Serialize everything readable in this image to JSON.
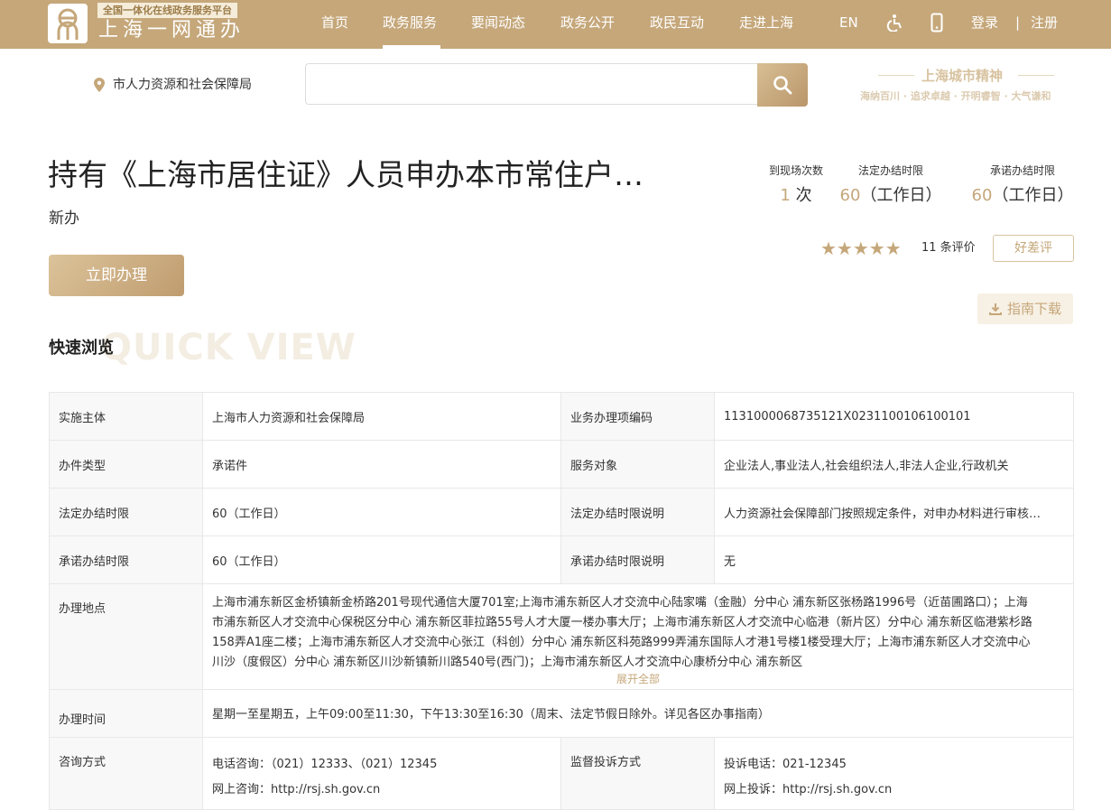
{
  "header": {
    "logo_tagline": "全国一体化在线政务服务平台",
    "logo_name": "上海一网通办",
    "nav": [
      "首页",
      "政务服务",
      "要闻动态",
      "政务公开",
      "政民互动",
      "走进上海"
    ],
    "lang": "EN",
    "login": "登录",
    "separator": "|",
    "register": "注册"
  },
  "search": {
    "location": "市人力资源和社会保障局",
    "placeholder": "",
    "spirit_title": "上海城市精神",
    "spirit_subtitle": "海纳百川 · 追求卓越 · 开明睿智 · 大气谦和"
  },
  "item": {
    "title": "持有《上海市居住证》人员申办本市常住户…",
    "subtitle": "新办",
    "apply_button": "立即办理",
    "stats": [
      {
        "label": "到现场次数",
        "num": "1",
        "unit": "次"
      },
      {
        "label": "法定办结时限",
        "num": "60",
        "unit": "（工作日）"
      },
      {
        "label": "承诺办结时限",
        "num": "60",
        "unit": "（工作日）"
      }
    ],
    "rating_stars": 5,
    "stars_text": "★★★★★",
    "review_count": "11 条评价",
    "review_button": "好差评",
    "guide_download": "指南下载"
  },
  "quick_view": {
    "title": "快速浏览",
    "bg_text": "QUICK VIEW",
    "rows": {
      "r1": {
        "l1": "实施主体",
        "v1": "上海市人力资源和社会保障局",
        "l2": "业务办理项编码",
        "v2": "1131000068735121X0231100106100101"
      },
      "r2": {
        "l1": "办件类型",
        "v1": "承诺件",
        "l2": "服务对象",
        "v2": "企业法人,事业法人,社会组织法人,非法人企业,行政机关"
      },
      "r3": {
        "l1": "法定办结时限",
        "v1": "60（工作日）",
        "l2": "法定办结时限说明",
        "v2": "人力资源社会保障部门按照规定条件，对申办材料进行审核…"
      },
      "r4": {
        "l1": "承诺办结时限",
        "v1": "60（工作日）",
        "l2": "承诺办结时限说明",
        "v2": "无"
      },
      "address": {
        "label": "办理地点",
        "value": "上海市浦东新区金桥镇新金桥路201号现代通信大厦701室;上海市浦东新区人才交流中心陆家嘴（金融）分中心 浦东新区张杨路1996号（近苗圃路口）；上海市浦东新区人才交流中心保税区分中心 浦东新区菲拉路55号人才大厦一楼办事大厅；上海市浦东新区人才交流中心临港（新片区）分中心 浦东新区临港紫杉路158弄A1座二楼；上海市浦东新区人才交流中心张江（科创）分中心 浦东新区科苑路999弄浦东国际人才港1号楼1楼受理大厅；上海市浦东新区人才交流中心川沙（度假区）分中心 浦东新区川沙新镇新川路540号(西门)；上海市浦东新区人才交流中心康桥分中心 浦东新区",
        "expand": "展开全部"
      },
      "hours": {
        "label": "办理时间",
        "value": "星期一至星期五，上午09:00至11:30，下午13:30至16:30（周末、法定节假日除外。详见各区办事指南）"
      },
      "contact": {
        "label": "咨询方式",
        "phone": "电话咨询：（021）12333、（021）12345",
        "web": "网上咨询：http://rsj.sh.gov.cn",
        "label2": "监督投诉方式",
        "complaint_phone": "投诉电话：021-12345",
        "complaint_web": "网上投诉：http://rsj.sh.gov.cn"
      }
    }
  },
  "colors": {
    "brand_gold": "#c5a77a",
    "header_bg": "#c5a77a"
  }
}
